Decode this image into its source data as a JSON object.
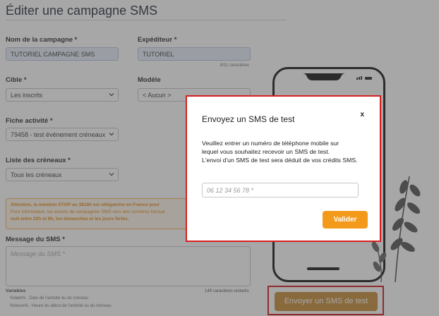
{
  "page": {
    "title": "Éditer une campagne SMS"
  },
  "form": {
    "campaign_name": {
      "label": "Nom de la campagne *",
      "value": "TUTORIEL CAMPAGNE SMS"
    },
    "sender": {
      "label": "Expéditeur *",
      "value": "TUTORIEL",
      "hint": "8/11 caractères"
    },
    "target": {
      "label": "Cible *",
      "value": "Les inscrits"
    },
    "template": {
      "label": "Modèle",
      "value": "< Aucun >"
    },
    "activity": {
      "label": "Fiche activité *",
      "value": "79458 - test événement créneaux"
    },
    "slots": {
      "label": "Liste des créneaux *",
      "value": "Tous les créneaux"
    },
    "warning": {
      "line1_strong": "Attention, la mention STOP au 38180 est obligatoire en France pour",
      "line2": "Pour information, les envois de campagnes SMS vers des numéros françai",
      "line3_strong": "nuit entre 22h et 8h, les dimanches et les jours fériés."
    },
    "message": {
      "label": "Message du SMS *",
      "placeholder": "Message du SMS *",
      "remaining": "149 caractères restants"
    },
    "variables": {
      "title": "Variables",
      "items": [
        "%date% : Date de l'activité ou du créneau",
        "%heure% : Heure du début de l'activité ou du créneau"
      ]
    }
  },
  "actions": {
    "send_test_label": "Envoyer un SMS de test"
  },
  "modal": {
    "title": "Envoyez un SMS de test",
    "close_label": "x",
    "body_line1": "Veuillez entrer un numéro de téléphone mobile sur",
    "body_line2": "lequel vous souhaitez recevoir un SMS de test.",
    "body_line3": "L'envoi d'un SMS de test sera déduit de vos crédits SMS.",
    "phone_placeholder": "06 12 34 56 78 *",
    "submit_label": "Valider"
  },
  "colors": {
    "accent_orange": "#f39a1a",
    "highlight_red": "#d62020",
    "warning_text": "#e58e1a"
  }
}
